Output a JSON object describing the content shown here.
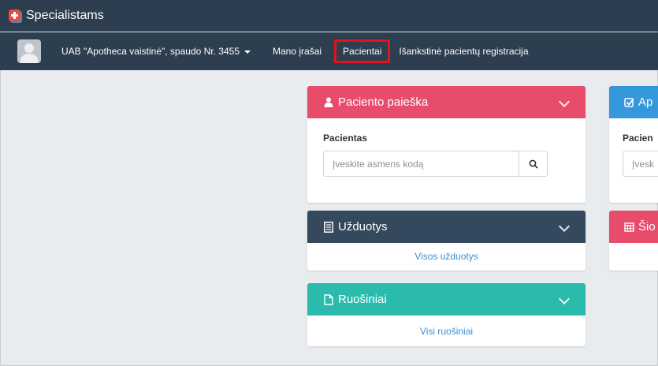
{
  "app": {
    "title": "Specialistams"
  },
  "navbar": {
    "company": "UAB \"Apotheca vaistinė\", spaudo Nr. 3455",
    "items": [
      {
        "label": "Mano įrašai"
      },
      {
        "label": "Pacientai"
      },
      {
        "label": "Išankstinė pacientų registracija"
      }
    ]
  },
  "panels": {
    "patient_search": {
      "title": "Paciento paieška",
      "field_label": "Pacientas",
      "placeholder": "Įveskite asmens kodą"
    },
    "second_top": {
      "title": "Ap",
      "field_label": "Pacien",
      "placeholder": "Įvesk"
    },
    "tasks": {
      "title": "Užduotys",
      "link": "Visos užduotys"
    },
    "today": {
      "title": "Šio"
    },
    "drafts": {
      "title": "Ruošiniai",
      "link": "Visi ruošiniai"
    }
  },
  "colors": {
    "topbar": "#2c3e50",
    "pink": "#e74c6b",
    "blue": "#3498db",
    "dark": "#34495e",
    "teal": "#2bbbad",
    "highlight": "#e3121b"
  }
}
